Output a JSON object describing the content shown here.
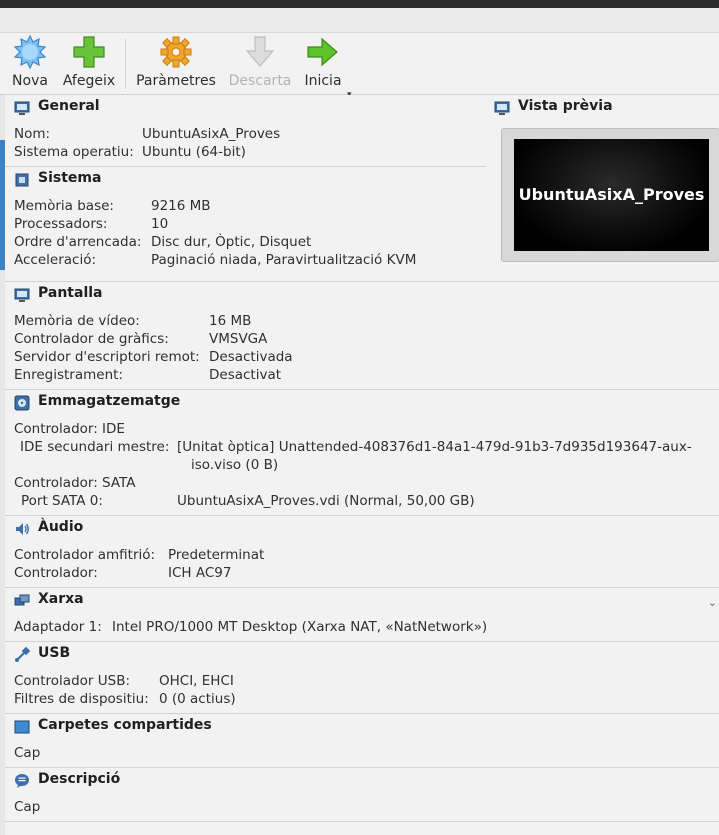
{
  "toolbar": {
    "new_label": "Nova",
    "add_label": "Afegeix",
    "settings_label": "Paràmetres",
    "discard_label": "Descarta",
    "start_label": "Inicia"
  },
  "general": {
    "title": "General",
    "name_key": "Nom:",
    "name_val": "UbuntuAsixA_Proves",
    "os_key": "Sistema operatiu:",
    "os_val": "Ubuntu (64-bit)"
  },
  "preview": {
    "title": "Vista prèvia",
    "screen_text": "UbuntuAsixA_Proves"
  },
  "system": {
    "title": "Sistema",
    "rows": [
      {
        "k": "Memòria base:",
        "v": "9216 MB"
      },
      {
        "k": "Processadors:",
        "v": "10"
      },
      {
        "k": "Ordre d'arrencada:",
        "v": "Disc dur, Òptic, Disquet"
      },
      {
        "k": "Acceleració:",
        "v": "Paginació niada, Paravirtualització KVM"
      }
    ]
  },
  "display": {
    "title": "Pantalla",
    "rows": [
      {
        "k": "Memòria de vídeo:",
        "v": "16 MB"
      },
      {
        "k": "Controlador de gràfics:",
        "v": "VMSVGA"
      },
      {
        "k": "Servidor d'escriptori remot:",
        "v": "Desactivada"
      },
      {
        "k": "Enregistrament:",
        "v": "Desactivat"
      }
    ]
  },
  "storage": {
    "title": "Emmagatzematge",
    "ctrl_ide": "Controlador: IDE",
    "ide_key": "IDE secundari mestre:",
    "ide_val_1": "[Unitat òptica] Unattended-408376d1-84a1-479d-91b3-7d935d193647-aux-",
    "ide_val_2": "iso.viso (0 B)",
    "ctrl_sata": "Controlador: SATA",
    "sata_key": "Port SATA 0:",
    "sata_val": "UbuntuAsixA_Proves.vdi (Normal, 50,00 GB)"
  },
  "audio": {
    "title": "Àudio",
    "rows": [
      {
        "k": "Controlador amfitrió:",
        "v": "Predeterminat"
      },
      {
        "k": "Controlador:",
        "v": "ICH AC97"
      }
    ]
  },
  "network": {
    "title": "Xarxa",
    "key": "Adaptador 1:",
    "val": "Intel PRO/1000 MT Desktop (Xarxa NAT, «NatNetwork»)"
  },
  "usb": {
    "title": "USB",
    "rows": [
      {
        "k": "Controlador USB:",
        "v": "OHCI, EHCI"
      },
      {
        "k": "Filtres de dispositiu:",
        "v": "0 (0 actius)"
      }
    ]
  },
  "shared": {
    "title": "Carpetes compartides",
    "val": "Cap"
  },
  "description": {
    "title": "Descripció",
    "val": "Cap"
  },
  "icons": {
    "new": "new-vm-icon",
    "add": "add-vm-icon",
    "settings": "settings-gear-icon",
    "discard": "discard-arrow-icon",
    "start": "start-arrow-icon"
  },
  "colors": {
    "accent": "#3d81c5",
    "start_green": "#59b82d",
    "settings_orange": "#f0a020"
  }
}
